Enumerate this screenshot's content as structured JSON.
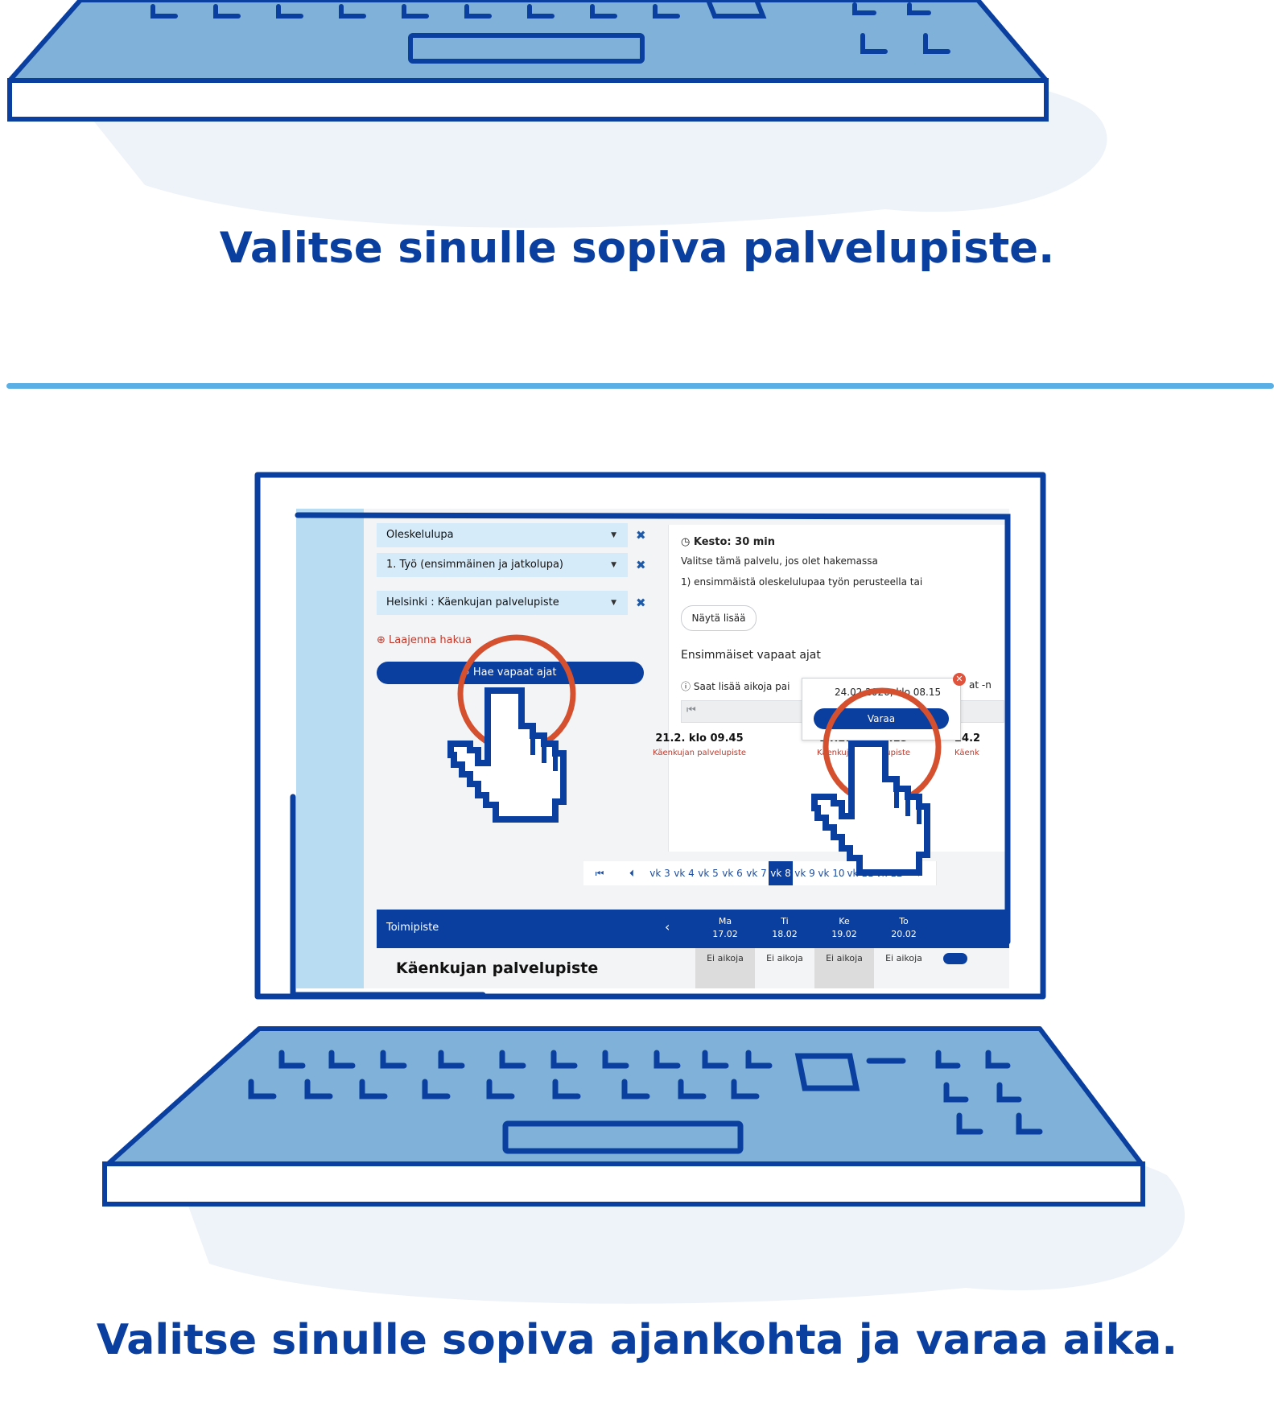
{
  "captions": {
    "step_location": "Valitse sinulle sopiva palvelupiste.",
    "step_time": "Valitse sinulle sopiva ajankohta ja varaa aika."
  },
  "colors": {
    "brand_blue": "#0a3fa0",
    "light_blue": "#7db0d8",
    "divider": "#5ab0e4",
    "accent_red": "#c0392b"
  },
  "screen": {
    "filters": [
      {
        "value": "Oleskelulupa"
      },
      {
        "value": "1. Työ (ensimmäinen ja jatkolupa)"
      },
      {
        "value": "Helsinki : Käenkujan palvelupiste"
      }
    ],
    "expand_search": "Laajenna hakua",
    "search_button": "Hae vapaat ajat",
    "duration": "Kesto: 30 min",
    "description_line1": "Valitse tämä palvelu, jos olet hakemassa",
    "description_line2": "1) ensimmäistä oleskelulupaa työn perusteella tai",
    "show_more": "Näytä lisää",
    "first_free_times": "Ensimmäiset vapaat ajat",
    "info_text": "Saat lisää aikoja pai",
    "info_text_right": "at -n",
    "popup_datetime": "24.02.2020, klo 08.15",
    "popup_button": "Varaa",
    "slots": [
      {
        "time": "21.2. klo 09.45",
        "location": "Käenkujan palvelupiste"
      },
      {
        "time": "24.2. klo 08.15",
        "location": "Käenkujan palvelupiste"
      },
      {
        "time": "24.2",
        "location": "Käenk"
      }
    ],
    "weeks": [
      "vk 3",
      "vk 4",
      "vk 5",
      "vk 6",
      "vk 7",
      "vk 8",
      "vk 9",
      "vk 10",
      "vk 11",
      "vk 12"
    ],
    "active_week": "vk 8",
    "table_header": "Toimipiste",
    "days": [
      {
        "name": "Ma",
        "date": "17.02",
        "status": "Ei aikoja"
      },
      {
        "name": "Ti",
        "date": "18.02",
        "status": "Ei aikoja"
      },
      {
        "name": "Ke",
        "date": "19.02",
        "status": "Ei aikoja"
      },
      {
        "name": "To",
        "date": "20.02",
        "status": "Ei aikoja"
      }
    ],
    "location_name": "Käenkujan palvelupiste"
  }
}
